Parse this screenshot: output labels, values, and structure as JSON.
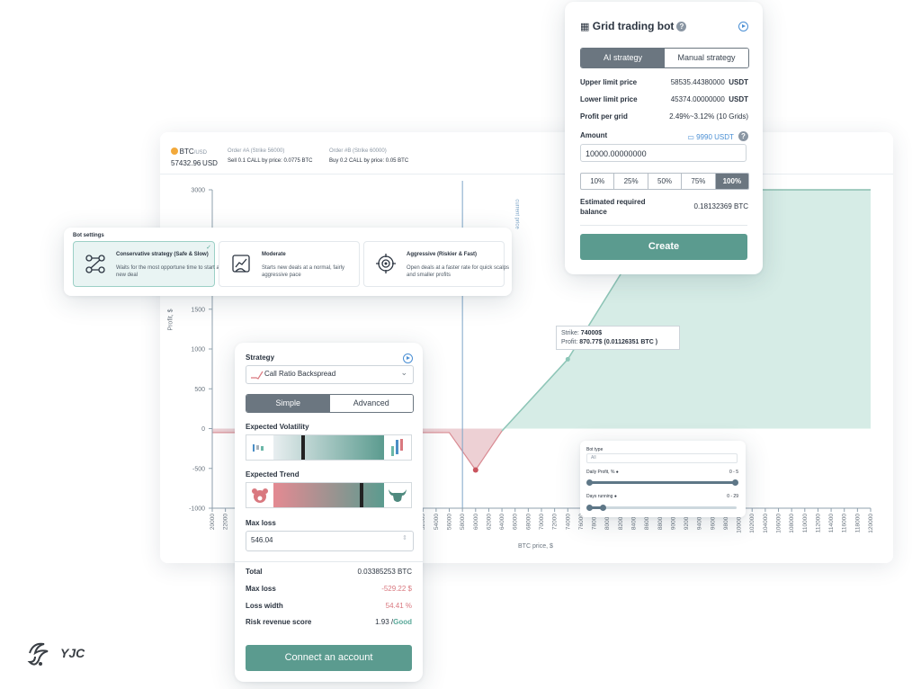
{
  "colors": {
    "accent": "#5b9b8f",
    "profit_area": "#d6ece6",
    "loss_area": "#eac8cd",
    "loss_text": "#d9787f",
    "good_text": "#5aa99a",
    "dark_btn": "#6b7680"
  },
  "chart_header": {
    "pair": "BTC",
    "pair_suffix": "/USD",
    "price": "57432.96",
    "price_unit": "USD",
    "order_a_title": "Order #A (Strike 56000)",
    "order_a_desc": "Sell 0.1 CALL by price: 0.0775 BTC",
    "order_b_title": "Order #B (Strike 60000)",
    "order_b_desc": "Buy 0.2 CALL by price: 0.05 BTC"
  },
  "chart_data": {
    "type": "area",
    "ylabel": "Profit, $",
    "xlabel": "BTC price, $",
    "current_price_label": "current price",
    "current_price_x": 58000,
    "ylim": [
      -1000,
      3000
    ],
    "xlim": [
      20000,
      120000
    ],
    "y_ticks": [
      -1000,
      -500,
      0,
      500,
      1000,
      1500,
      2000,
      2500,
      3000
    ],
    "x_ticks": [
      20000,
      22000,
      24000,
      26000,
      28000,
      30000,
      32000,
      34000,
      36000,
      38000,
      40000,
      42000,
      44000,
      46000,
      48000,
      50000,
      52000,
      54000,
      56000,
      58000,
      60000,
      62000,
      64000,
      66000,
      68000,
      70000,
      72000,
      74000,
      76000,
      78000,
      80000,
      82000,
      84000,
      86000,
      88000,
      90000,
      92000,
      94000,
      96000,
      98000,
      100000,
      102000,
      104000,
      106000,
      108000,
      110000,
      112000,
      114000,
      116000,
      118000,
      120000
    ],
    "series": [
      {
        "x": [
          20000,
          56000,
          60000,
          64000,
          74000,
          90000,
          120000
        ],
        "values": [
          -50,
          -50,
          -520,
          -30,
          870.77,
          3000,
          3000
        ]
      }
    ],
    "tooltip": {
      "strike_label": "Strike:",
      "strike": "74000$",
      "profit_label": "Profit:",
      "profit": "870.77$ (0.01126351 BTC )"
    }
  },
  "bot_settings": {
    "title": "Bot settings",
    "options": [
      {
        "name": "Conservative strategy (Safe & Slow)",
        "desc": "Waits for the most opportune time to start a new deal",
        "icon": "network-icon"
      },
      {
        "name": "Moderate",
        "desc": "Starts new deals at a normal, fairly aggressive pace",
        "icon": "chart-hand-icon"
      },
      {
        "name": "Aggressive (Riskier & Fast)",
        "desc": "Open deals at a faster rate for quick scalps and smaller profits",
        "icon": "target-icon"
      }
    ]
  },
  "grid_bot": {
    "title": "Grid trading bot",
    "tabs": [
      "AI strategy",
      "Manual strategy"
    ],
    "upper_label": "Upper limit price",
    "upper_value": "58535.44380000",
    "lower_label": "Lower limit price",
    "lower_value": "45374.00000000",
    "currency": "USDT",
    "profit_label": "Profit per grid",
    "profit_value": "2.49%~3.12% (10 Grids)",
    "amount_label": "Amount",
    "balance": "9990 USDT",
    "amount_value": "10000.00000000",
    "percents": [
      "10%",
      "25%",
      "50%",
      "75%",
      "100%"
    ],
    "est_label": "Estimated required balance",
    "est_value": "0.18132369 BTC",
    "create_label": "Create"
  },
  "strategy": {
    "title": "Strategy",
    "selected": "Call Ratio Backspread",
    "tabs": [
      "Simple",
      "Advanced"
    ],
    "volatility_label": "Expected Volatility",
    "volatility_level": 0.25,
    "trend_label": "Expected Trend",
    "trend_level": 0.78,
    "max_loss_label": "Max loss",
    "max_loss_value": "546.04",
    "total_label": "Total",
    "total_value": "0.03385253 BTC",
    "maxloss_sum_label": "Max loss",
    "maxloss_sum_value": "-529.22 $",
    "width_label": "Loss width",
    "width_value": "54.41 %",
    "risk_label": "Risk revenue score",
    "risk_value": "1.93 /",
    "risk_grade": "Good",
    "connect_label": "Connect an account"
  },
  "filters": {
    "bot_type_label": "Bot type",
    "bot_type_value": "All",
    "daily_label": "Daily Profit, %",
    "daily_range": "0 - 5",
    "days_label": "Days running",
    "days_range": "0 - 29"
  },
  "logo": {
    "text": "YJC"
  }
}
